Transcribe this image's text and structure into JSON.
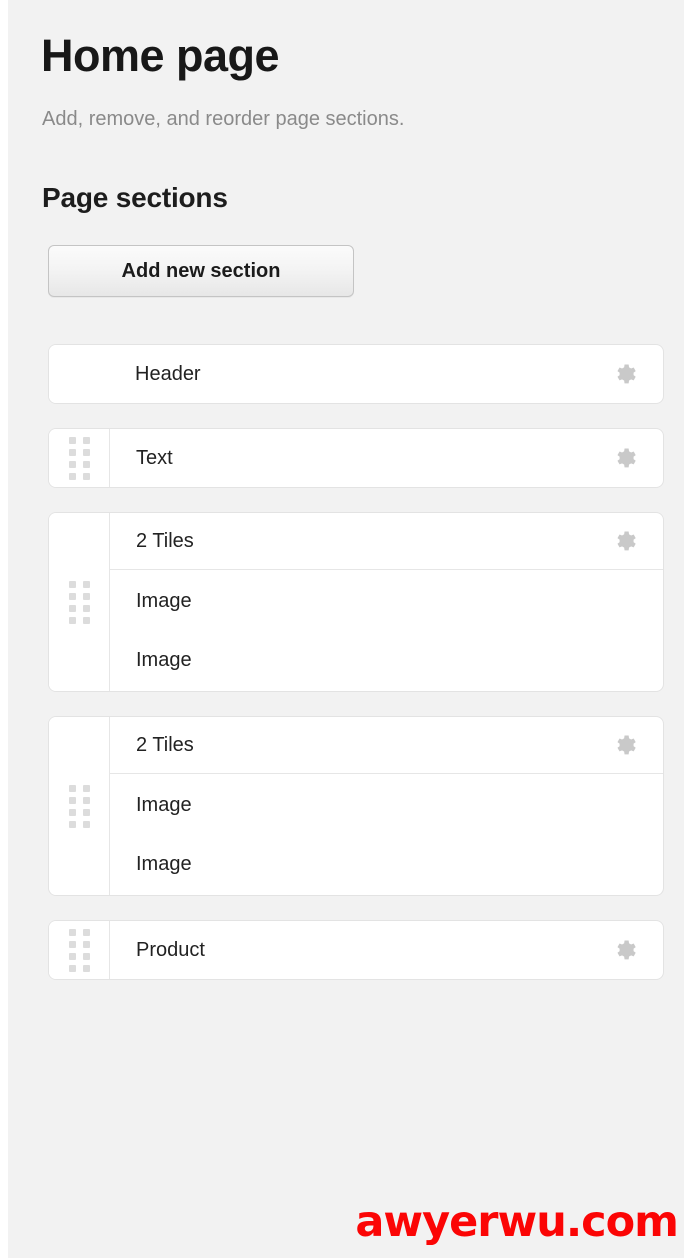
{
  "header": {
    "title": "Home page",
    "subtitle": "Add, remove, and reorder page sections."
  },
  "sections_panel": {
    "heading": "Page sections",
    "add_button_label": "Add new section"
  },
  "icons": {
    "gear": "gear-icon",
    "drag": "drag-handle-icon"
  },
  "colors": {
    "page_background": "#f2f2f2",
    "card_background": "#ffffff",
    "card_border": "#e3e3e3",
    "title_text": "#181818",
    "subtitle_text": "#8a8a8a",
    "row_text": "#222222",
    "gear_icon": "#c9c9c9",
    "grip_dot": "#dcdcdc",
    "watermark": "#fb0505"
  },
  "sections": [
    {
      "label": "Header",
      "type": "simple",
      "draggable": false,
      "has_settings": true,
      "children": []
    },
    {
      "label": "Text",
      "type": "simple",
      "draggable": true,
      "has_settings": true,
      "children": []
    },
    {
      "label": "2 Tiles",
      "type": "group",
      "draggable": true,
      "has_settings": true,
      "children": [
        {
          "label": "Image"
        },
        {
          "label": "Image"
        }
      ]
    },
    {
      "label": "2 Tiles",
      "type": "group",
      "draggable": true,
      "has_settings": true,
      "children": [
        {
          "label": "Image"
        },
        {
          "label": "Image"
        }
      ]
    },
    {
      "label": "Product",
      "type": "simple",
      "draggable": true,
      "has_settings": true,
      "children": []
    }
  ],
  "watermark": {
    "text": "awyerwu.com"
  }
}
